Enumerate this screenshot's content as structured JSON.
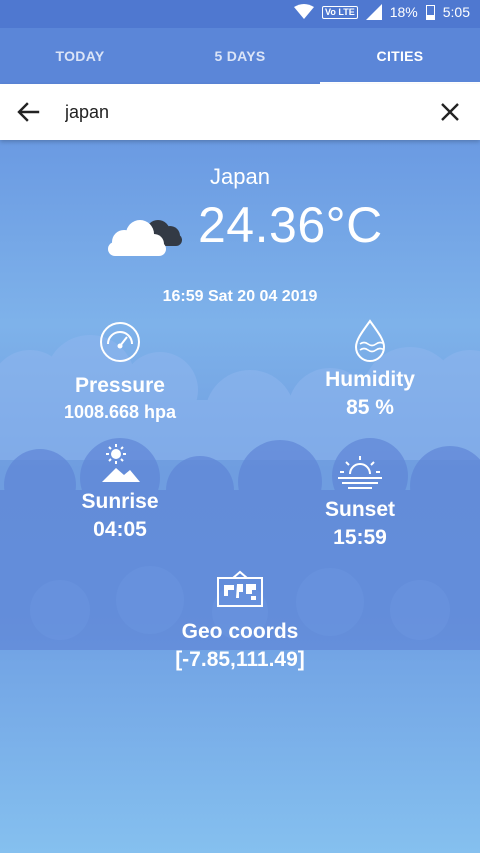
{
  "status_bar": {
    "network_badge": "Vo LTE",
    "battery": "18%",
    "time": "5:05"
  },
  "tabs": [
    {
      "label": "TODAY"
    },
    {
      "label": "5 DAYS"
    },
    {
      "label": "CITIES"
    }
  ],
  "search": {
    "value": "japan"
  },
  "weather": {
    "city": "Japan",
    "temperature": "24.36°C",
    "datetime": "16:59 Sat 20 04 2019",
    "pressure_label": "Pressure",
    "pressure_value": "1008.668 hpa",
    "humidity_label": "Humidity",
    "humidity_value": "85 %",
    "sunrise_label": "Sunrise",
    "sunrise_value": "04:05",
    "sunset_label": "Sunset",
    "sunset_value": "15:59",
    "geo_label": "Geo coords",
    "geo_value": "[-7.85,111.49]"
  },
  "icons": [
    "wifi-icon",
    "signal-icon",
    "battery-icon",
    "back-arrow-icon",
    "close-icon",
    "cloud-icon",
    "gauge-icon",
    "water-drop-icon",
    "sunrise-icon",
    "sunset-icon",
    "map-icon"
  ]
}
